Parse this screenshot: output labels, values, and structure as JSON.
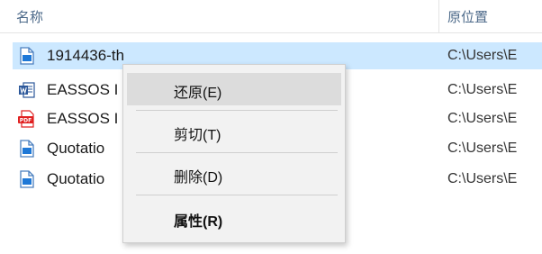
{
  "columns": {
    "name": "名称",
    "location": "原位置"
  },
  "files": [
    {
      "name": "1914436-th",
      "location": "C:\\Users\\E",
      "icon": "image-file-icon",
      "selected": true
    },
    {
      "name": "EASSOS I",
      "location": "C:\\Users\\E",
      "icon": "word-file-icon",
      "selected": false
    },
    {
      "name": "EASSOS I",
      "location": "C:\\Users\\E",
      "icon": "pdf-file-icon",
      "selected": false
    },
    {
      "name": "Quotatio",
      "location": "C:\\Users\\E",
      "icon": "image-file-icon",
      "selected": false
    },
    {
      "name": "Quotatio",
      "location": "C:\\Users\\E",
      "icon": "image-file-icon",
      "selected": false
    }
  ],
  "context_menu": {
    "restore": "还原(E)",
    "cut": "剪切(T)",
    "delete": "删除(D)",
    "properties": "属性(R)"
  },
  "colors": {
    "selection": "#cce8ff",
    "menu_background": "#f2f2f2",
    "menu_hover": "#dcdcdc",
    "word_blue": "#2b579a",
    "pdf_red": "#e02020"
  }
}
